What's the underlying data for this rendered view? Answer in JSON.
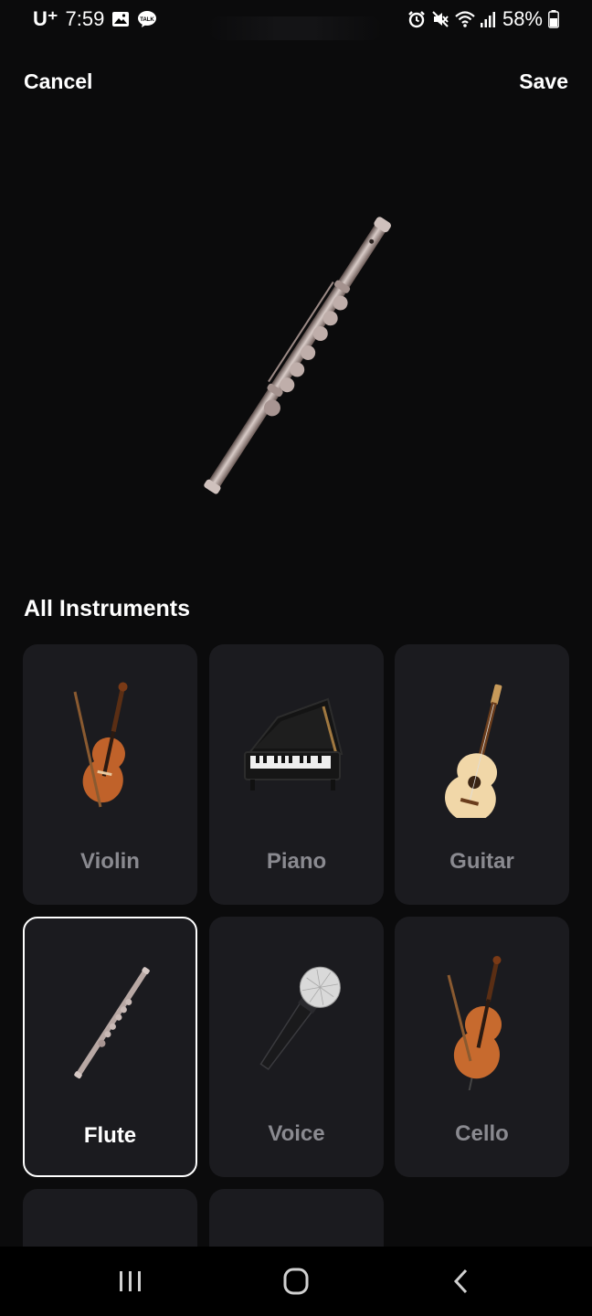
{
  "status_bar": {
    "carrier": "U⁺",
    "time": "7:59",
    "battery": "58%",
    "left_icons": [
      "gallery-icon",
      "talk-icon"
    ],
    "right_icons": [
      "alarm-icon",
      "mute-icon",
      "wifi-icon",
      "signal-icon",
      "battery-icon"
    ]
  },
  "topbar": {
    "cancel_label": "Cancel",
    "save_label": "Save"
  },
  "hero": {
    "selected_instrument": "Flute",
    "icon": "flute-icon"
  },
  "section": {
    "title": "All Instruments"
  },
  "instruments": [
    {
      "label": "Violin",
      "icon": "violin-icon",
      "selected": false
    },
    {
      "label": "Piano",
      "icon": "piano-icon",
      "selected": false
    },
    {
      "label": "Guitar",
      "icon": "guitar-icon",
      "selected": false
    },
    {
      "label": "Flute",
      "icon": "flute-icon",
      "selected": true
    },
    {
      "label": "Voice",
      "icon": "microphone-icon",
      "selected": false
    },
    {
      "label": "Cello",
      "icon": "cello-icon",
      "selected": false
    }
  ],
  "nav_bar": {
    "buttons": [
      "recent-apps-icon",
      "home-icon",
      "back-icon"
    ]
  },
  "colors": {
    "background": "#0b0b0c",
    "card": "#1b1b1f",
    "label_inactive": "#8a8a90",
    "label_active": "#ffffff",
    "wood": "#c0622a",
    "metal": "#b8a8a4"
  }
}
